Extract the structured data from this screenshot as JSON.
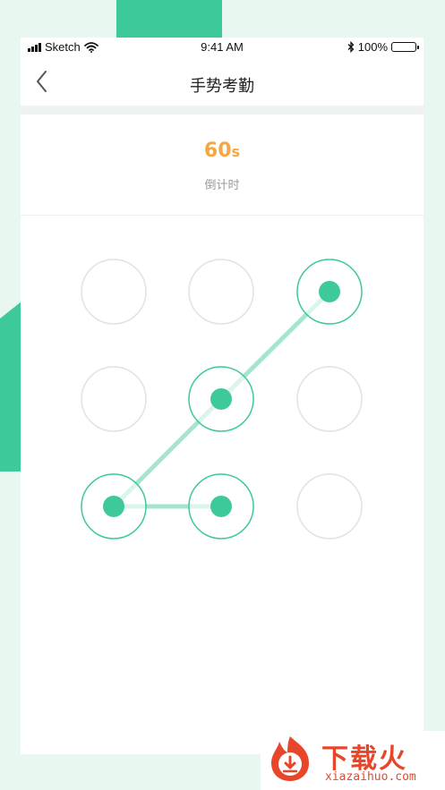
{
  "status_bar": {
    "carrier": "Sketch",
    "time": "9:41 AM",
    "battery": "100%"
  },
  "nav": {
    "title": "手势考勤",
    "back_icon": "chevron-left-icon"
  },
  "countdown": {
    "value": "60",
    "unit": "s",
    "label": "倒计时"
  },
  "pattern": {
    "grid": 3,
    "nodes": [
      1,
      2,
      3,
      4,
      5,
      6,
      7,
      8,
      9
    ],
    "selected_sequence": [
      3,
      5,
      7,
      8
    ],
    "colors": {
      "active": "#3ec99a",
      "line": "#a3e6cd",
      "inactive_border": "#e2e2e2"
    }
  },
  "watermark": {
    "brand": "下载火",
    "site": "xiazaihuo.com"
  },
  "colors": {
    "accent": "#3ec99a",
    "countdown": "#f5a742"
  }
}
